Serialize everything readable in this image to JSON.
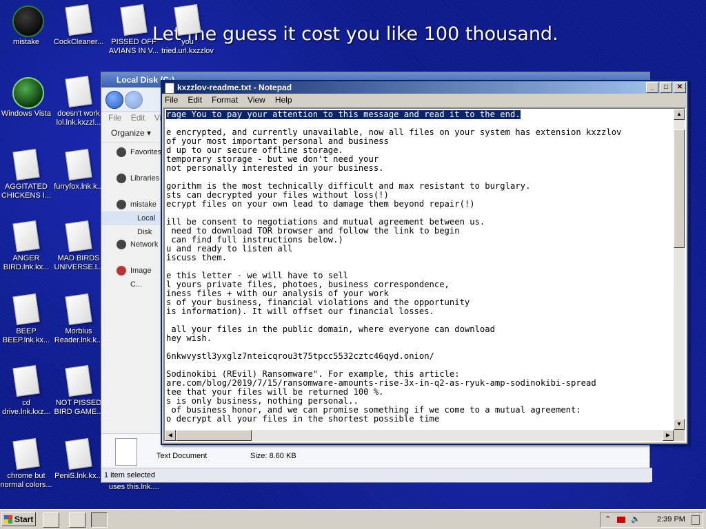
{
  "overlay": {
    "message": "Let me guess it cost you like 100 thousand."
  },
  "desktop": {
    "icons": [
      {
        "label": "mistake",
        "kind": "orb"
      },
      {
        "label": "CockCleaner...",
        "kind": "doc"
      },
      {
        "label": "PISSED OFF AVIANS IN V...",
        "kind": "doc"
      },
      {
        "label": "you tried.url.kxzzlov",
        "kind": "doc"
      },
      {
        "label": "Windows Vista",
        "kind": "orb-green"
      },
      {
        "label": "doesn't work lol.lnk.kxzzl...",
        "kind": "doc"
      },
      {
        "label": "AGGITATED CHICKENS I...",
        "kind": "doc"
      },
      {
        "label": "furryfox.lnk.k...",
        "kind": "doc"
      },
      {
        "label": "ANGER BIRD.lnk.kx...",
        "kind": "doc"
      },
      {
        "label": "MAD BIRDS UNIVERSE.l...",
        "kind": "doc"
      },
      {
        "label": "BEEP BEEP.lnk.kx...",
        "kind": "doc"
      },
      {
        "label": "Morbius Reader.lnk.k...",
        "kind": "doc"
      },
      {
        "label": "cd drive.lnk.kxz...",
        "kind": "doc"
      },
      {
        "label": "NOT PISSED BIRD GAME...",
        "kind": "doc"
      },
      {
        "label": "chrome but normal colors...",
        "kind": "doc"
      },
      {
        "label": "PeniS.lnk.kx...",
        "kind": "doc"
      }
    ]
  },
  "explorer": {
    "title": "Local Disk (C:)",
    "menu": [
      "File",
      "Edit",
      "View"
    ],
    "organize": "Organize",
    "sidebar": [
      "Favorites",
      "Libraries",
      "mistake",
      "Local Disk",
      "Network",
      "Image C..."
    ],
    "details": {
      "type": "Text Document",
      "size": "Size: 8.60 KB"
    },
    "status": "1 item selected",
    "partial_label": "uses this.lnk...."
  },
  "notepad": {
    "title": "kxzzlov-readme.txt - Notepad",
    "menu": [
      "File",
      "Edit",
      "Format",
      "View",
      "Help"
    ],
    "selected_line": "rage You to pay your attention to this message and read it to the end.",
    "lines": [
      "",
      "e encrypted, and currently unavailable, now all files on your system has extension kxzzlov",
      "of your most important personal and business",
      "d up to our secure offline storage.",
      "temporary storage - but we don't need your",
      "not personally interested in your business.",
      "",
      "gorithm is the most technically difficult and max resistant to burglary.",
      "sts can decrypted your files without loss(!)",
      "ecrypt files on your own lead to damage them beyond repair(!)",
      "",
      "ill be consent to negotiations and mutual agreement between us.",
      " need to download TOR browser and follow the link to begin",
      " can find full instructions below.)",
      "u and ready to listen all",
      "iscuss them.",
      "",
      "e this letter - we will have to sell",
      "l yours private files, photoes, business correspondence,",
      "iness files + with our analysis of your work",
      "s of your business, financial violations and the opportunity",
      "is information). It will offset our financial losses.",
      "",
      " all your files in the public domain, where everyone can download",
      "hey wish.",
      "",
      "6nkwvystl3yxglz7nteicqrou3t75tpcc5532cztc46qyd.onion/",
      "",
      "Sodinokibi (REvil) Ransomware\". For example, this article:",
      "are.com/blog/2019/7/15/ransomware-amounts-rise-3x-in-q2-as-ryuk-amp-sodinokibi-spread",
      "tee that your files will be returned 100 %.",
      "s is only business, nothing personal..",
      " of business honor, and we can promise something if we come to a mutual agreement:",
      "o decrypt all your files in the shortest possible time"
    ]
  },
  "taskbar": {
    "start_label": "Start",
    "clock": "2:39 PM"
  }
}
